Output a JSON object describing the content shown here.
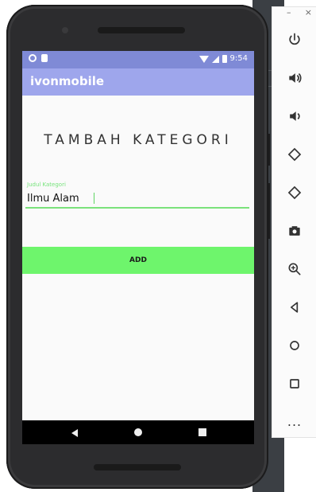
{
  "emulator": {
    "window_controls": {
      "minimize": "–",
      "close": "×"
    },
    "toolbar_buttons": [
      {
        "icon": "power-icon"
      },
      {
        "icon": "volume-up-icon"
      },
      {
        "icon": "volume-down-icon"
      },
      {
        "icon": "rotate-left-icon"
      },
      {
        "icon": "rotate-right-icon"
      },
      {
        "icon": "camera-icon"
      },
      {
        "icon": "zoom-icon"
      },
      {
        "icon": "back-icon"
      },
      {
        "icon": "home-icon"
      },
      {
        "icon": "overview-icon"
      },
      {
        "icon": "more-icon",
        "label": "..."
      }
    ]
  },
  "phone": {
    "status_bar": {
      "time": "9:54"
    },
    "app_bar": {
      "title": "ivonmobile"
    },
    "screen": {
      "title": "TAMBAH KATEGORI",
      "field": {
        "label": "Judul Kategori",
        "value": "Ilmu Alam"
      },
      "button": {
        "label": "ADD"
      }
    }
  },
  "colors": {
    "status_bar": "#7f8ad6",
    "app_bar": "#9ea6ec",
    "accent_green": "#6ef56c"
  }
}
